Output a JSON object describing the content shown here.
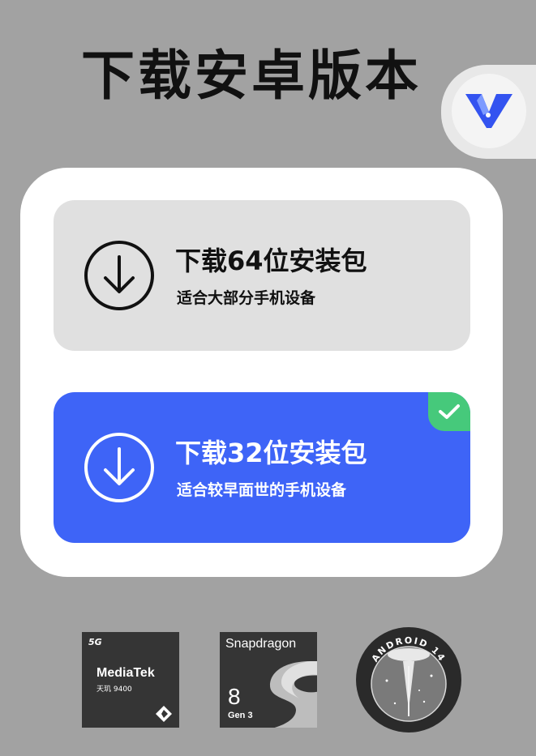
{
  "page": {
    "title": "下载安卓版本"
  },
  "options": [
    {
      "title": "下载64位安装包",
      "subtitle": "适合大部分手机设备",
      "selected": false
    },
    {
      "title": "下载32位安装包",
      "subtitle": "适合较早面世的手机设备",
      "selected": true
    }
  ],
  "icons": {
    "download": "download-arrow-icon",
    "check": "check-icon",
    "app_logo": "v-logo-icon"
  },
  "colors": {
    "background": "#a2a2a2",
    "card": "#ffffff",
    "option_default": "#e0e0e0",
    "option_selected": "#3e64f7",
    "check_badge": "#46c97b",
    "logo_blue": "#3353f0"
  },
  "badges": {
    "mediatek": {
      "network": "5G",
      "brand": "MediaTek",
      "model": "天玑 9400"
    },
    "snapdragon": {
      "brand": "Snapdragon",
      "number": "8",
      "gen": "Gen 3"
    },
    "android": {
      "text": "ANDROID 14"
    }
  }
}
